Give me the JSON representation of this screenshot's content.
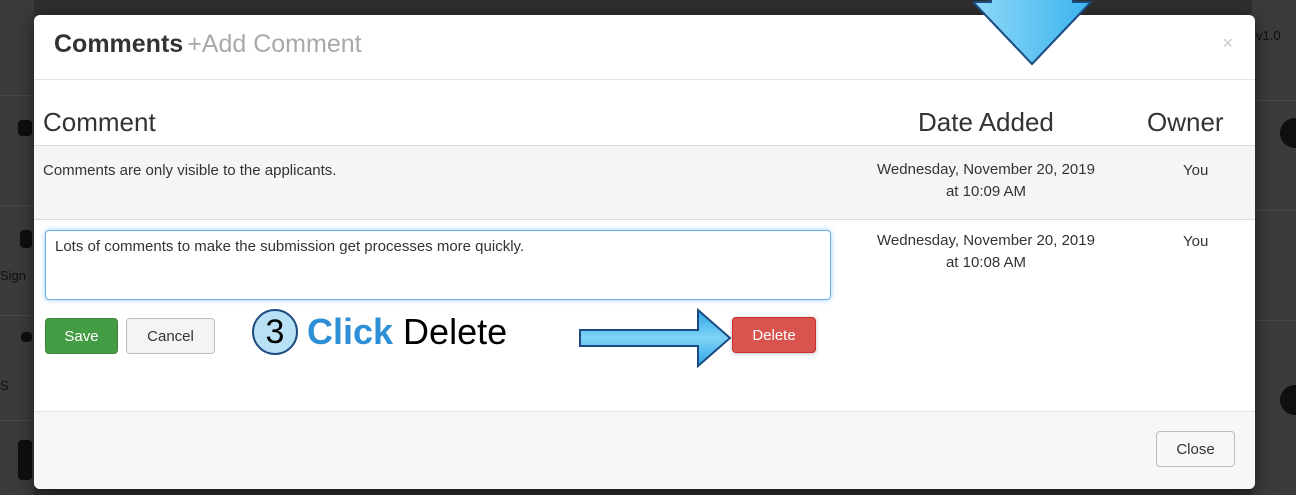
{
  "background": {
    "right_version": "v1.0",
    "left_fragments": [
      "Sign",
      "S"
    ]
  },
  "modal": {
    "title": "Comments",
    "add_link": "+Add Comment",
    "close_x": "×",
    "columns": {
      "comment": "Comment",
      "date": "Date Added",
      "owner": "Owner"
    },
    "rows": [
      {
        "comment": "Comments are only visible to the applicants.",
        "date_line1": "Wednesday, November 20, 2019",
        "date_line2": "at 10:09 AM",
        "owner": "You"
      },
      {
        "comment": "Lots of comments to make the submission get processes more quickly.",
        "date_line1": "Wednesday, November 20, 2019",
        "date_line2": "at 10:08 AM",
        "owner": "You"
      }
    ],
    "buttons": {
      "save": "Save",
      "cancel": "Cancel",
      "delete": "Delete"
    },
    "footer": {
      "close": "Close"
    }
  },
  "annotation": {
    "step_number": "3",
    "strong": "Click",
    "rest": " Delete"
  },
  "colors": {
    "save": "#449d44",
    "delete": "#d9534f",
    "annotation_arrow": "#4fc3f7",
    "annotation_text": "#2d8fd6"
  }
}
